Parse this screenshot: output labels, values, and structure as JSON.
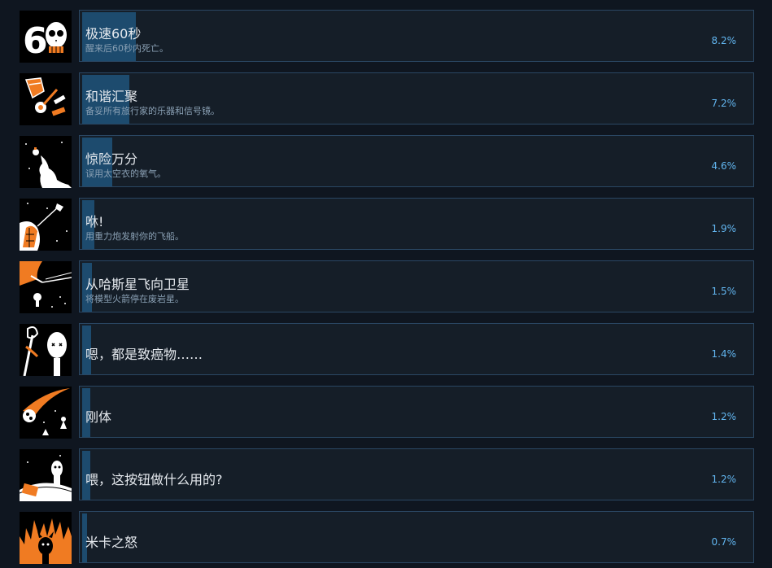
{
  "colors": {
    "background": "#0f1620",
    "panel": "#151e28",
    "panel_border": "#2a4763",
    "progress_bar": "#1d4b6e",
    "title_text": "#e5e9ee",
    "description_text": "#8aa0b4",
    "percent_text": "#62b6f0",
    "icon_orange": "#f07b22"
  },
  "achievements": [
    {
      "title": "极速60秒",
      "description": "醒来后60秒内死亡。",
      "percent": "8.2%",
      "icon": "skull-60-icon",
      "unlock_fraction": 0.082
    },
    {
      "title": "和谐汇聚",
      "description": "备妥所有旅行家的乐器和信号镜。",
      "percent": "7.2%",
      "icon": "instruments-icon",
      "unlock_fraction": 0.072
    },
    {
      "title": "惊险万分",
      "description": "误用太空衣的氧气。",
      "percent": "4.6%",
      "icon": "astronaut-jet-icon",
      "unlock_fraction": 0.046
    },
    {
      "title": "咻!",
      "description": "用重力炮发射你的飞船。",
      "percent": "1.9%",
      "icon": "ship-launch-icon",
      "unlock_fraction": 0.019
    },
    {
      "title": "从哈斯星飞向卫星",
      "description": "将模型火箭停在废岩星。",
      "percent": "1.5%",
      "icon": "model-rocket-icon",
      "unlock_fraction": 0.015
    },
    {
      "title": "嗯，都是致癌物……",
      "description": "",
      "percent": "1.4%",
      "icon": "alien-staff-icon",
      "unlock_fraction": 0.014
    },
    {
      "title": "刚体",
      "description": "",
      "percent": "1.2%",
      "icon": "meteor-icon",
      "unlock_fraction": 0.012
    },
    {
      "title": "喂，这按钮做什么用的?",
      "description": "",
      "percent": "1.2%",
      "icon": "alien-button-icon",
      "unlock_fraction": 0.012
    },
    {
      "title": "米卡之怒",
      "description": "",
      "percent": "0.7%",
      "icon": "fire-devil-icon",
      "unlock_fraction": 0.007
    }
  ]
}
